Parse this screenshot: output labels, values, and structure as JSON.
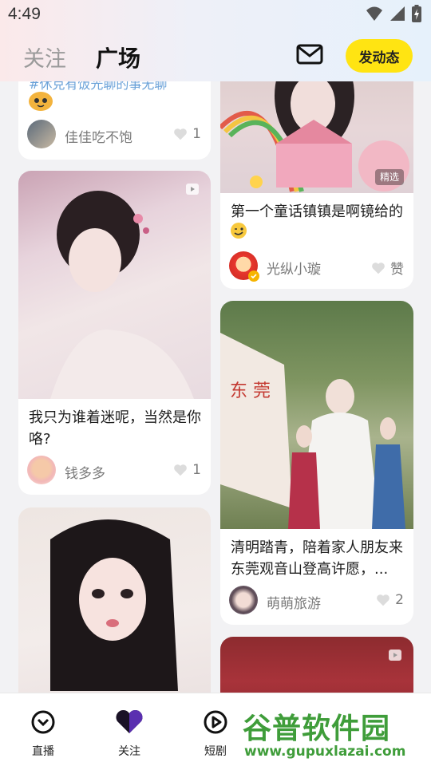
{
  "status_bar": {
    "time": "4:49"
  },
  "top_nav": {
    "tab_follow": "关注",
    "tab_square": "广场",
    "post_button": "发动态",
    "mail_icon": "mail-icon"
  },
  "feed": {
    "left_column": [
      {
        "title_fragment": "#休克有饭光聊的事无聊",
        "author": "佳佳吃不饱",
        "likes": "1"
      },
      {
        "title": "我只为谁着迷呢，当然是你咯?",
        "author": "钱多多",
        "likes": "1"
      },
      {
        "title": "",
        "author": "",
        "likes": ""
      }
    ],
    "right_column": [
      {
        "title": "第一个童话镇镇是啊镜给的",
        "badge": "精选",
        "author": "光纵小璇",
        "likes": "赞"
      },
      {
        "title": "清明踏青，陪着家人朋友来东莞观音山登高许愿，...",
        "author": "萌萌旅游",
        "likes": "2"
      },
      {
        "title": "",
        "author": "",
        "likes": ""
      }
    ]
  },
  "bottom_nav": {
    "items": [
      {
        "label": "直播",
        "icon": "live-icon"
      },
      {
        "label": "关注",
        "icon": "heart-icon"
      },
      {
        "label": "短剧",
        "icon": "play-circle-icon"
      }
    ]
  },
  "watermark": {
    "title": "谷普软件园",
    "url": "www.gupuxlazai.com"
  },
  "colors": {
    "accent": "#ffe412",
    "watermark": "#3f9d3a",
    "background": "#f2f2f4"
  }
}
